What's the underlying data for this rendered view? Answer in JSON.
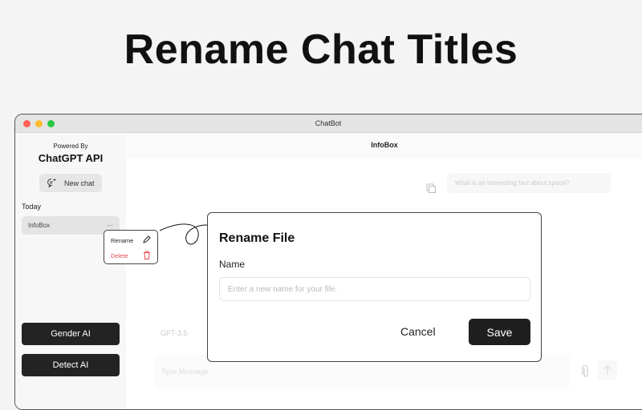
{
  "hero_title": "Rename Chat Titles",
  "window": {
    "title": "ChatBot"
  },
  "sidebar": {
    "powered_by": "Powered By",
    "api_name": "ChatGPT API",
    "new_chat": "New chat",
    "section": "Today",
    "items": [
      {
        "label": "InfoBox",
        "more": "···"
      }
    ],
    "buttons": [
      "Gender AI",
      "Detect AI"
    ]
  },
  "main": {
    "header": "InfoBox",
    "question": "What is an interesting fact about space?",
    "model": "GPT-3.5",
    "message_placeholder": "Type Message"
  },
  "context_menu": {
    "rename": "Rename",
    "delete": "Delete"
  },
  "dialog": {
    "title": "Rename File",
    "label": "Name",
    "placeholder": "Enter a new name for your file.",
    "cancel": "Cancel",
    "save": "Save"
  },
  "colors": {
    "delete": "#e5484d",
    "dark": "#232323"
  }
}
